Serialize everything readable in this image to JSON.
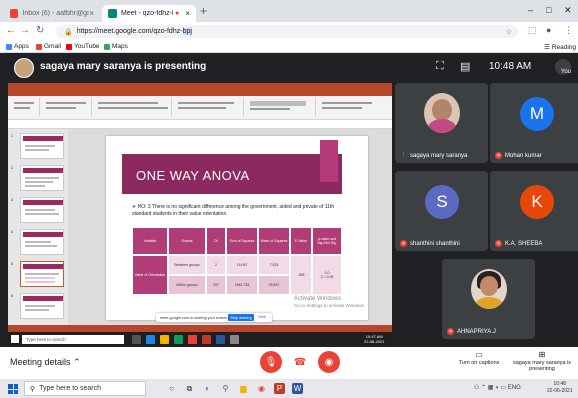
{
  "browser": {
    "tabs": [
      {
        "label": "Inbox (6) - aafbhr@gmail.com",
        "active": false
      },
      {
        "label": "Meet - qzo-fdhz-bpj",
        "active": true
      }
    ],
    "url_prefix": "https://meet.google.com/qzo-fdhz-",
    "url_selected": "bpj",
    "bookmarks": [
      "Apps",
      "Gmail",
      "YouTube",
      "Maps"
    ],
    "reading_list": "Reading"
  },
  "meet": {
    "presenter_title": "sagaya mary saranya is presenting",
    "clock": "10:48 AM",
    "you_label": "You",
    "participants": [
      {
        "name": "sagaya mary saranya",
        "type": "photo",
        "mic": "on"
      },
      {
        "name": "Mohan kumar",
        "initial": "M",
        "color": "#1a73e8",
        "mic": "off"
      },
      {
        "name": "shanthini shanthini",
        "initial": "S",
        "color": "#5c6bc0",
        "mic": "off"
      },
      {
        "name": "K.A. SHEEBA",
        "initial": "K",
        "color": "#e8470a",
        "mic": "off"
      },
      {
        "name": "AHNAPRIYA.J",
        "type": "photo",
        "mic": "off"
      }
    ],
    "meeting_details": "Meeting details",
    "captions_label": "Turn on captions",
    "presenting_label": "sagaya mary saranya is presenting"
  },
  "slide": {
    "title": "ONE WAY ANOVA",
    "hypothesis": "HO: 3 There is no significant difference among the government, aided and private of 11th standard students in their value orientation.",
    "table": {
      "headers": [
        "Variable",
        "Source",
        "Df",
        "Sum of Squares",
        "Mean of Squares",
        "F-Value",
        "p-value and Sig./Not Sig."
      ],
      "row_variable": "Value of Orientation",
      "rows": [
        [
          "Between groups",
          "2",
          "15.067",
          "7.533"
        ],
        [
          "Within groups",
          "297",
          "1561.733",
          "25.897"
        ]
      ],
      "f_value": ".298",
      "sig": "0.0\n2 > 0.05"
    },
    "share_bar": {
      "text": "meet.google.com is sharing your screen.",
      "stop": "Stop sharing",
      "hide": "Hide"
    },
    "watermark": [
      "Activate Windows",
      "Go to Settings to activate Windows."
    ],
    "inner_search": "Type here to search",
    "inner_time": "10:47 AM\n22-06-2021"
  },
  "taskbar": {
    "search_placeholder": "Type here to search",
    "time": "10:48",
    "date": "22-06-2021",
    "lang": "ENG"
  }
}
